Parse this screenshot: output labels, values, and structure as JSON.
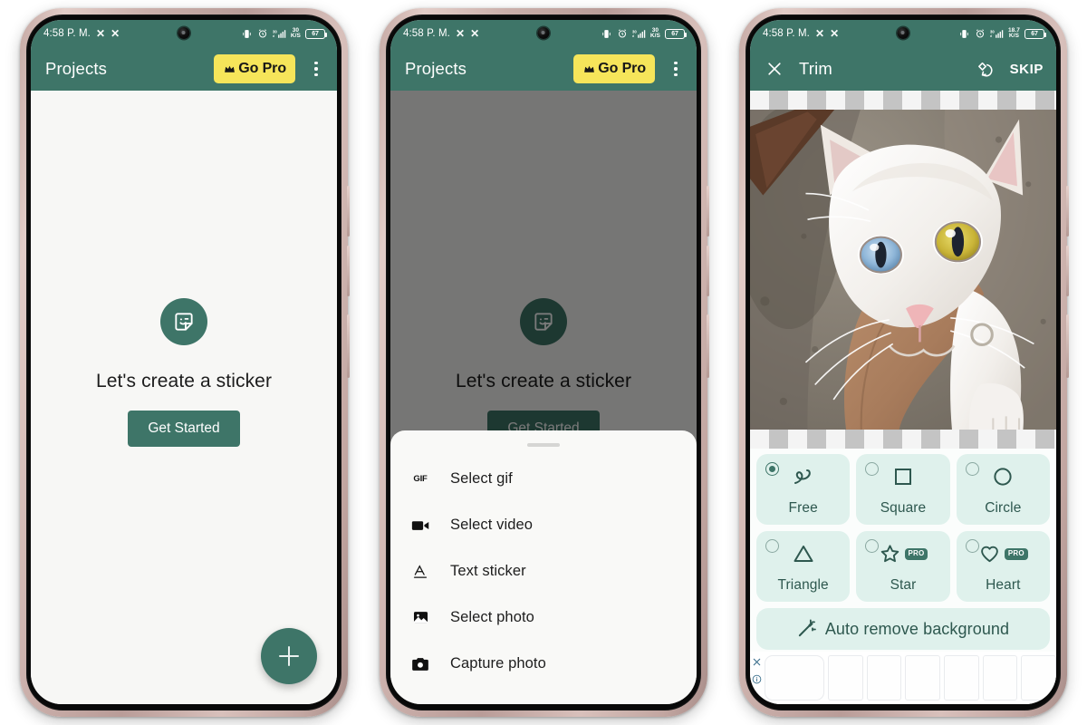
{
  "status_bar": {
    "time": "4:58 P. M.",
    "icons_left": [
      "close-x-icon",
      "close-x-icon"
    ],
    "icons_right": [
      "vibrate-icon",
      "alarm-icon",
      "signal-3g-icon",
      "network-speed-icon",
      "battery-icon"
    ],
    "network_speed_value": "30",
    "network_speed_unit": "K/S",
    "network_speed_value_p3": "18.7",
    "battery_percent": "67"
  },
  "phone1": {
    "appbar": {
      "title": "Projects",
      "go_pro_label": "Go Pro",
      "go_pro_icon": "crown-icon",
      "overflow_icon": "kebab-menu-icon"
    },
    "empty_state": {
      "icon": "sticker-smiley-icon",
      "title": "Let's create a sticker",
      "button_label": "Get Started"
    },
    "fab": {
      "icon": "plus-icon",
      "label": "Add project"
    }
  },
  "phone2": {
    "appbar": {
      "title": "Projects",
      "go_pro_label": "Go Pro",
      "go_pro_icon": "crown-icon",
      "overflow_icon": "kebab-menu-icon"
    },
    "empty_state": {
      "icon": "sticker-smiley-icon",
      "title": "Let's create a sticker",
      "button_label": "Get Started"
    },
    "sheet": {
      "items": [
        {
          "label": "Select gif",
          "icon": "gif-icon"
        },
        {
          "label": "Select video",
          "icon": "video-camera-icon"
        },
        {
          "label": "Text sticker",
          "icon": "text-format-icon"
        },
        {
          "label": "Select photo",
          "icon": "image-icon"
        },
        {
          "label": "Capture photo",
          "icon": "camera-icon"
        }
      ]
    }
  },
  "phone3": {
    "appbar": {
      "close_icon": "close-x-icon",
      "title": "Trim",
      "rotate_icon": "rotate-flip-icon",
      "skip_label": "SKIP"
    },
    "preview": {
      "alt": "white cat with one blue eye and one yellow eye held in a hand",
      "transparency_checkerboard": true
    },
    "shape_options": [
      {
        "label": "Free",
        "icon": "freehand-icon",
        "selected": true,
        "pro": false
      },
      {
        "label": "Square",
        "icon": "square-icon",
        "selected": false,
        "pro": false
      },
      {
        "label": "Circle",
        "icon": "circle-icon",
        "selected": false,
        "pro": false
      },
      {
        "label": "Triangle",
        "icon": "triangle-icon",
        "selected": false,
        "pro": false
      },
      {
        "label": "Star",
        "icon": "star-icon",
        "selected": false,
        "pro": true
      },
      {
        "label": "Heart",
        "icon": "heart-icon",
        "selected": false,
        "pro": true
      }
    ],
    "pro_badge_label": "PRO",
    "auto_remove": {
      "label": "Auto remove background",
      "icon": "magic-wand-icon"
    },
    "ad": {
      "close_icon": "close-x-icon",
      "info_icon": "info-icon"
    }
  },
  "colors": {
    "brand_green": "#3e7568",
    "go_pro_yellow": "#f6e55a",
    "option_bg": "#dff1ec",
    "option_text": "#2e584f",
    "screen_bg": "#f7f7f5"
  }
}
